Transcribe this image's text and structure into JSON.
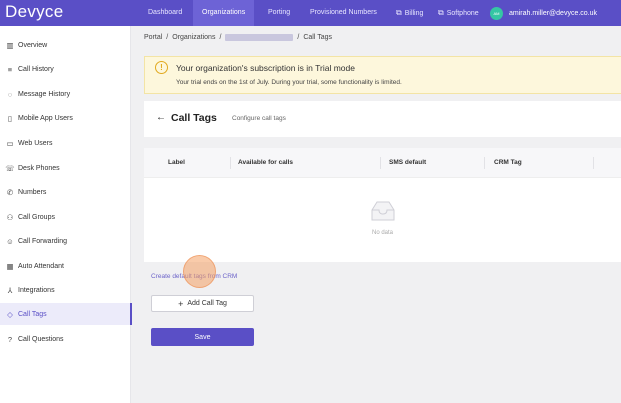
{
  "app": {
    "logo": "Devyce"
  },
  "nav": {
    "dashboard": "Dashboard",
    "organizations": "Organizations",
    "porting": "Porting",
    "provisioned_numbers": "Provisioned Numbers",
    "billing": "Billing",
    "softphone": "Softphone",
    "user_initials": "AM",
    "user_email": "amirah.miller@devyce.co.uk"
  },
  "sidebar": {
    "items": [
      {
        "label": "Overview",
        "icon": "chart-icon"
      },
      {
        "label": "Call History",
        "icon": "list-icon"
      },
      {
        "label": "Message History",
        "icon": "chat-icon"
      },
      {
        "label": "Mobile App Users",
        "icon": "phone-mobile-icon"
      },
      {
        "label": "Web Users",
        "icon": "monitor-icon"
      },
      {
        "label": "Desk Phones",
        "icon": "desk-phone-icon"
      },
      {
        "label": "Numbers",
        "icon": "phone-icon"
      },
      {
        "label": "Call Groups",
        "icon": "group-icon"
      },
      {
        "label": "Call Forwarding",
        "icon": "forward-user-icon"
      },
      {
        "label": "Auto Attendant",
        "icon": "calculator-icon"
      },
      {
        "label": "Integrations",
        "icon": "integrations-icon"
      },
      {
        "label": "Call Tags",
        "icon": "tag-icon"
      },
      {
        "label": "Call Questions",
        "icon": "question-icon"
      }
    ],
    "active_index": 11
  },
  "breadcrumb": {
    "portal": "Portal",
    "organizations": "Organizations",
    "current": "Call Tags"
  },
  "banner": {
    "title": "Your organization's subscription is in Trial mode",
    "message": "Your trial ends on the 1st of July. During your trial, some functionality is limited."
  },
  "page": {
    "title": "Call Tags",
    "subtitle": "Configure call tags"
  },
  "table": {
    "columns": [
      "Label",
      "Available for calls",
      "SMS default",
      "CRM Tag"
    ],
    "empty_text": "No data"
  },
  "actions": {
    "crm_link": "Create default tags from CRM",
    "add_call_tag": "Add Call Tag",
    "save": "Save"
  },
  "colors": {
    "primary": "#5a4fc6",
    "banner_bg": "#fdf7dc",
    "warning": "#e1a91f"
  }
}
